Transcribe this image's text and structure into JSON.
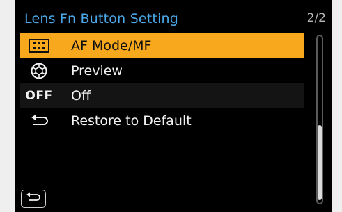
{
  "header": {
    "title": "Lens Fn Button Setting",
    "page_indicator": "2/2"
  },
  "menu": {
    "items": [
      {
        "label": "AF Mode/MF",
        "icon": "af-mode-icon",
        "selected": true
      },
      {
        "label": "Preview",
        "icon": "aperture-icon",
        "selected": false
      },
      {
        "label": "Off",
        "icon": "off-icon",
        "icon_text": "OFF",
        "selected": false
      },
      {
        "label": "Restore to Default",
        "icon": "restore-icon",
        "selected": false
      }
    ]
  },
  "colors": {
    "title": "#4aa8e8",
    "selection": "#f7a81d",
    "background": "#000000"
  },
  "footer": {
    "back_icon": "back-arrow-icon"
  }
}
